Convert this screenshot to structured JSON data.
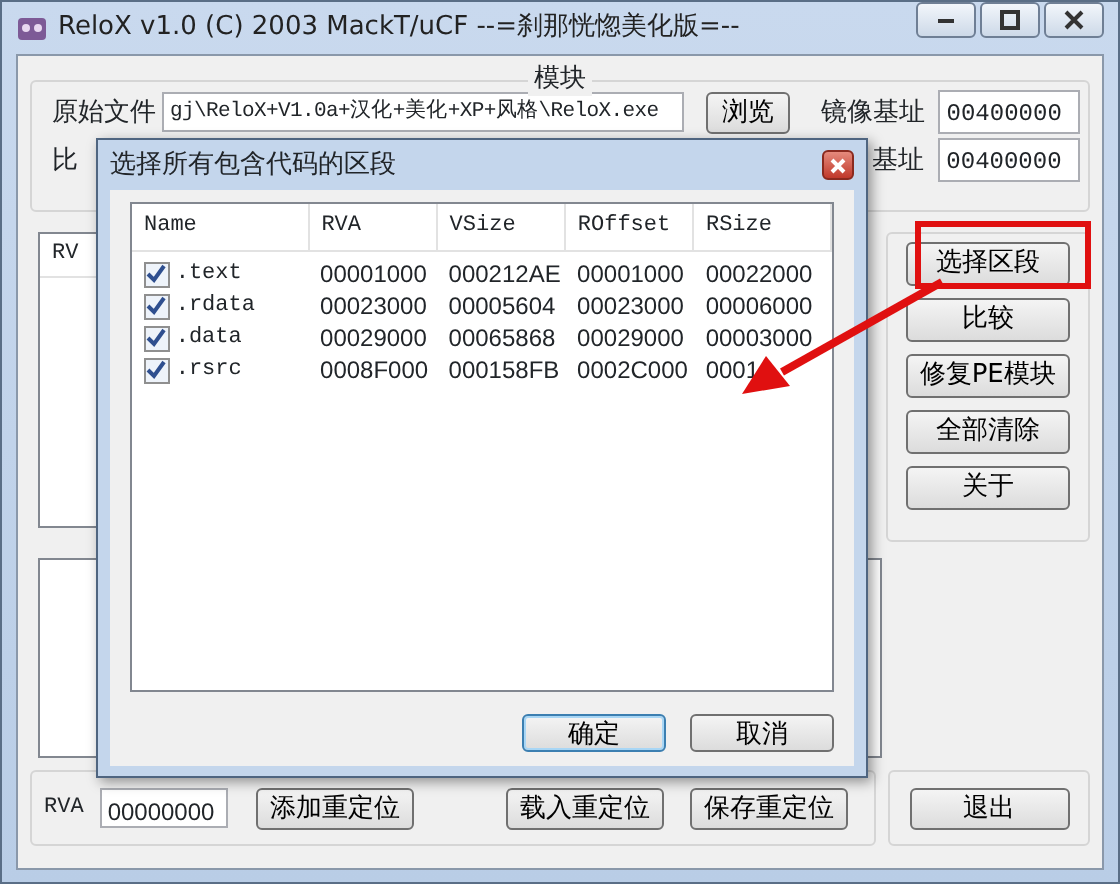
{
  "window": {
    "title": "ReloX v1.0 (C) 2003 MackT/uCF --=刹那恍惚美化版=--"
  },
  "module_group": {
    "title": "模块",
    "row_1": {
      "label": "原始文件",
      "path": "gj\\ReloX+V1.0a+汉化+美化+XP+风格\\ReloX.exe",
      "browse": "浏览",
      "base_label": "镜像基址",
      "base": "00400000"
    },
    "row_2": {
      "label": "比",
      "base_label": "基址",
      "base": "00400000"
    }
  },
  "list_header": "RV",
  "side_buttons": [
    "选择区段",
    "比较",
    "修复PE模块",
    "全部清除",
    "关于"
  ],
  "bottom": {
    "rva_label": "RVA",
    "rva": "00000000",
    "buttons": [
      "添加重定位",
      "载入重定位",
      "保存重定位"
    ],
    "exit": "退出"
  },
  "dialog": {
    "title": "选择所有包含代码的区段",
    "columns": [
      "Name",
      "RVA",
      "VSize",
      "ROffset",
      "RSize"
    ],
    "rows": [
      {
        "checked": true,
        "cells": [
          ".text",
          "00001000",
          "000212AE",
          "00001000",
          "00022000"
        ]
      },
      {
        "checked": true,
        "cells": [
          ".rdata",
          "00023000",
          "00005604",
          "00023000",
          "00006000"
        ]
      },
      {
        "checked": true,
        "cells": [
          ".data",
          "00029000",
          "00065868",
          "00029000",
          "00003000"
        ]
      },
      {
        "checked": true,
        "cells": [
          ".rsrc",
          "0008F000",
          "000158FB",
          "0002C000",
          "0001"
        ]
      }
    ],
    "buttons": [
      {
        "label": "确定",
        "default": true
      },
      {
        "label": "取消",
        "default": false
      }
    ]
  }
}
